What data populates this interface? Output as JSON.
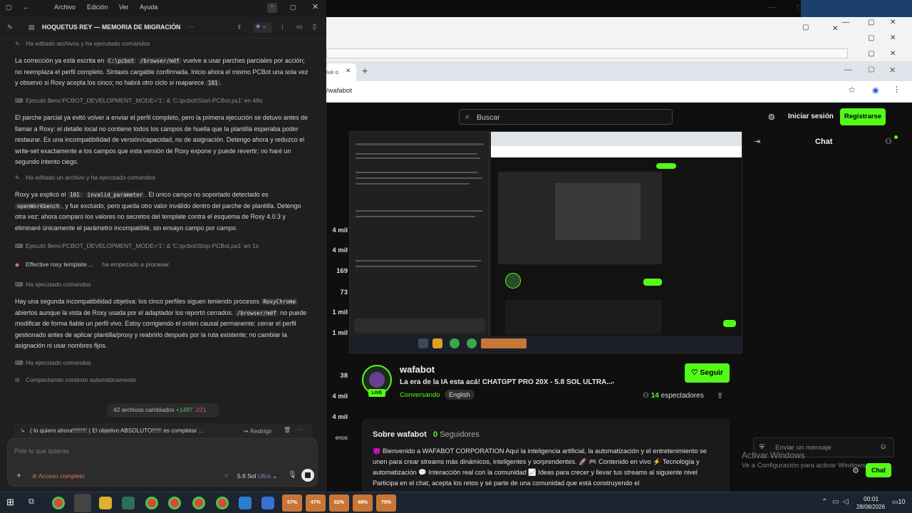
{
  "left_app": {
    "menu": [
      "Archivo",
      "Edición",
      "Ver",
      "Ayuda"
    ],
    "conversation_title": "HOQUETUS REY — MEMORIA DE MIGRACIÓN",
    "more_glyph": "···",
    "events": [
      "Ha editado archivos y ha ejecutado comandos",
      "Ejecutó $env:PCBOT_DEVELOPMENT_MODE='1'; & 'C:\\pcbot\\Start-PCBot.ps1' en 49s",
      "Ha editado un archivo y ha ejecutado comandos",
      "Ejecutó $env:PCBOT_DEVELOPMENT_MODE='1'; & 'C:\\pcbot\\Stop-PCBot.ps1' en 1s",
      "Ha ejecutado comandos",
      "Ha ejecutado comandos",
      "Compactando contexto automáticamente"
    ],
    "processing_item": "Effective roxy template ...",
    "processing_status": "ha empezado a procesar",
    "para1": {
      "t1": "La corrección ya está escrita en ",
      "c1": "C:\\pcbot",
      "t2": " ",
      "c2": "/browser/mdf",
      "t3": " vuelve a usar parches parciales por acción; no reemplaza el perfil completo. Sintaxis cargable confirmada. Inicio ahora el mismo PCBot una sola vez y observo si Roxy acepta los cinco; no habrá otro ciclo si reaparece ",
      "c3": "101",
      "t4": "."
    },
    "para2": "El parche parcial ya evitó volver a enviar el perfil completo, pero la primera ejecución se detuvo antes de llamar a Roxy: el detalle local no contiene todos los campos de huella que la plantilla esperaba poder restaurar. Es una incompatibilidad de versión/capacidad, no de asignación. Detengo ahora y reduzco el write-set exactamente a los campos que esta versión de Roxy expone y puede revertir; no haré un segundo intento ciego.",
    "para3": {
      "t1": "Roxy ya explicó el ",
      "c1": "101",
      "t2": ": ",
      "c2": "invalid_parameter",
      "t3": ". El único campo no soportado detectado es ",
      "c3": "openWorkbench",
      "t4": ", y fue excluido, pero queda otro valor inválido dentro del parche de plantilla. Detengo otra vez; ahora comparo los valores no secretos del template contra el esquema de Roxy 4.0.3 y eliminaré únicamente el parámetro incompatible, sin ensayo campo por campo."
    },
    "para4": {
      "t1": "Hay una segunda incompatibilidad objetiva: los cinco perfiles siguen teniendo procesos ",
      "c1": "RoxyChrome",
      "t2": " abiertos aunque la vista de Roxy usada por el adaptador los reportó cerrados. ",
      "c2": "/browser/mdf",
      "t3": " no puede modificar de forma fiable un perfil vivo. Estoy corrigiendo el orden causal permanente: cerrar el perfil gestionado antes de aplicar plantilla/proxy y reabrirlo después por la ruta existente; no cambiar la asignación ni usar nombres fijos."
    },
    "files_changed": "42 archivos cambiados",
    "lines_added": "+1487",
    "lines_removed": "-221",
    "queued_message": "( lo quiero ahora!!!!!!!!! ( El objetivo ABSOLUTO!!!!!! es  completar ...",
    "redirect_label": "Redirigir",
    "composer_placeholder": "Pide lo que quieras",
    "access_label": "Acceso completo",
    "model_name": "5.6 Sol",
    "model_tier": "Ultra"
  },
  "browser": {
    "tab_title": "ive o",
    "url": "/wafabot"
  },
  "kick": {
    "search_placeholder": "Buscar",
    "login_label": "Iniciar sesión",
    "register_label": "Registrarse",
    "chat_title": "Chat",
    "viewer_counts": [
      "4 mil",
      "4 mil",
      "169",
      "73",
      "1 mil",
      "1 mil",
      "38",
      "4 mil",
      "4 mil",
      "enos"
    ],
    "channel_name": "wafabot",
    "live_badge": "LIVE",
    "stream_title": "La era de la  IA esta acá! CHATGPT PRO 20X - 5.8 SOL ULTRA...",
    "category": "Conversando",
    "language": "English",
    "follow_label": "Seguir",
    "viewers_count": "14",
    "viewers_label": "espectadores",
    "about_title": "Sobre wafabot",
    "followers_count": "0",
    "followers_label": "Seguidores",
    "about_text": "😈 Bienvenido a WAFABOT CORPORATION Aquí la inteligencia artificial, la automatización y el entretenimiento se unen para crear streams más dinámicos, inteligentes y sorprendentes. 🚀 🎮 Contenido en vivo ⚡ Tecnología y automatización 💬 Interacción real con la comunidad 📈 Ideas para crecer y llevar tus streams al siguiente nivel Participa en el chat, acepta los retos y sé parte de una comunidad que está construyendo el",
    "chat_placeholder": "Enviar un mensaje",
    "chat_send": "Chat"
  },
  "windows": {
    "activate_title": "Activar Windows",
    "activate_sub": "Ve a Configuración para activar Windows.",
    "time": "00:01",
    "date": "28/08/2026",
    "notif_count": "10",
    "thumb_labels": [
      "57%",
      "47%",
      "82%",
      "48%",
      "79%"
    ]
  },
  "colors": {
    "kick_green": "#53fc18",
    "app_bg": "#1f1f1f",
    "taskbar": "#1c2430"
  }
}
